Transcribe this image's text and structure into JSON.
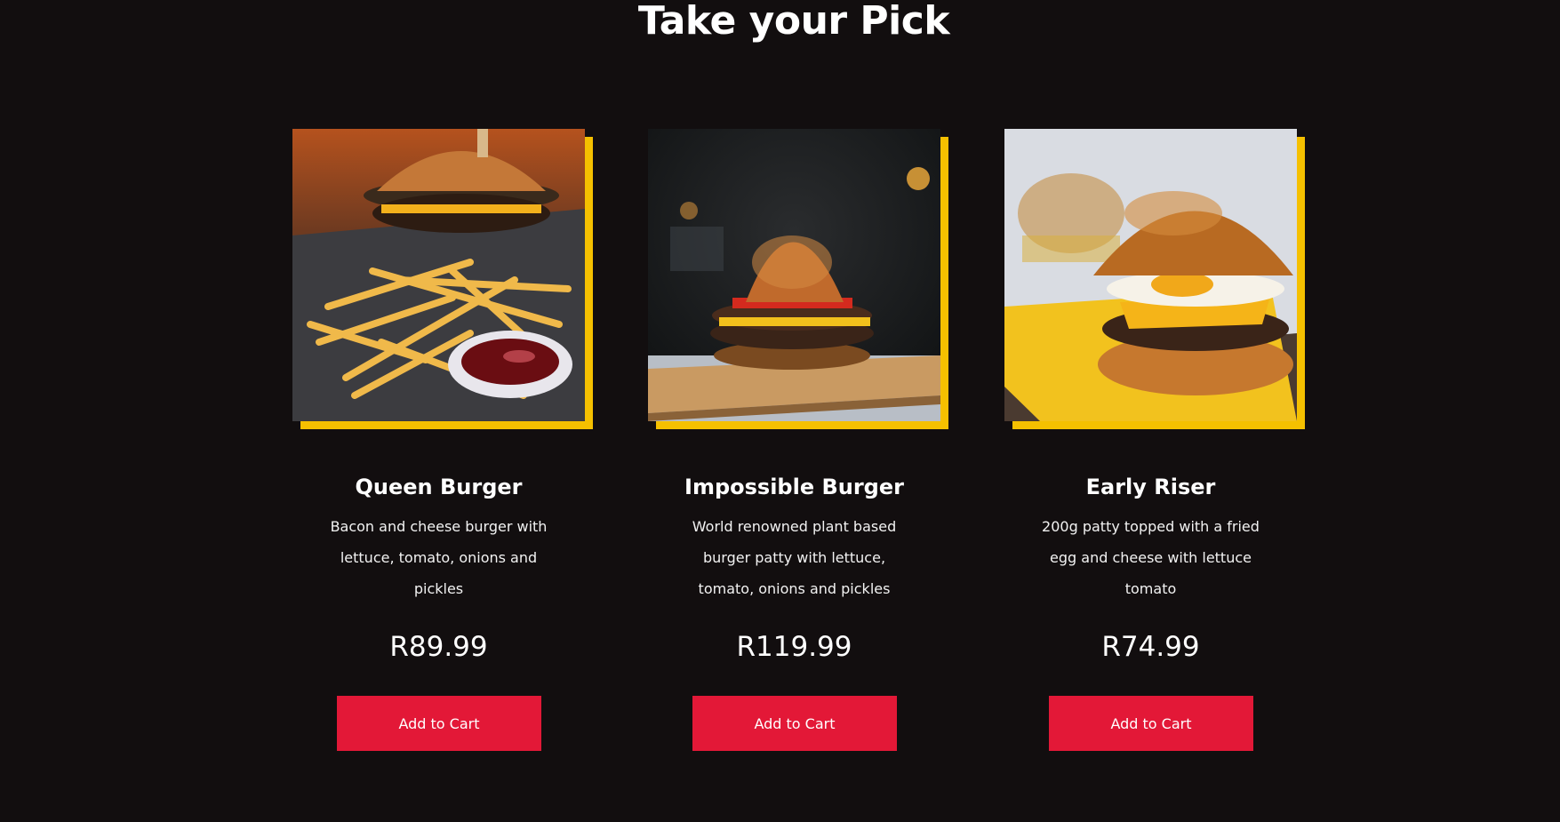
{
  "section": {
    "title": "Take your Pick"
  },
  "colors": {
    "background": "#120e0f",
    "accent": "#f5c000",
    "button": "#e31837"
  },
  "products": [
    {
      "name": "Queen Burger",
      "description": "Bacon and cheese burger with lettuce, tomato, onions and pickles",
      "price": "R89.99",
      "button_label": "Add to Cart",
      "image_icon": "burger-with-fries-photo"
    },
    {
      "name": "Impossible Burger",
      "description": "World renowned plant based burger patty with lettuce, tomato, onions and pickles",
      "price": "R119.99",
      "button_label": "Add to Cart",
      "image_icon": "burger-on-board-photo"
    },
    {
      "name": "Early Riser",
      "description": "200g patty topped with a fried egg and cheese with lettuce tomato",
      "price": "R74.99",
      "button_label": "Add to Cart",
      "image_icon": "egg-burger-photo"
    }
  ]
}
